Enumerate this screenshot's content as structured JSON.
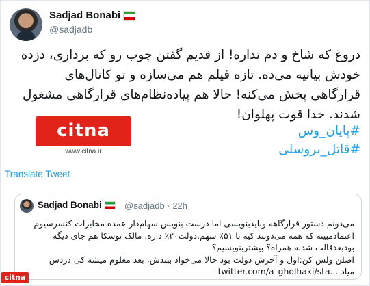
{
  "tweet": {
    "author_name": "Sadjad Bonabi",
    "author_handle": "@sadjadb",
    "text": "دروغ که شاخ و دم نداره! از قدیم گفتن چوب رو که برداری، دزده خودش بیانیه می‌ده. تازه فیلم هم می‌سازه و تو کانال‌های قرارگاهی پخش می‌کنه! حالا هم پیاده‌نظام‌های قرارگاهی مشغول شدند. خدا قوت پهلوان!",
    "hashtags": [
      "#پایان_وس",
      "#قاتل_بروسلی"
    ],
    "translate_label": "Translate Tweet"
  },
  "quoted_tweet": {
    "author_name": "Sadjad Bonabi",
    "author_handle": "@sadjadb",
    "time": "22h",
    "lines": [
      "می‌دونم دستور قرارگاهه وبایدبنویسی اما درست بنویس سهام‌دار عمده مخابرات کنسرسیوم",
      "اعتمادمبینه که همه می‌دونند کیه با ۵۱٪ سهم.دولت۲۰٪ داره. مالک توسکا هم جای دیگه",
      "بودبعدقالب شدبه همراه؟ بیشتربنویسیم؟",
      "اصلن ولش کن:اول و آخرش دولت بود حالا می‌خواد ببندش، بعد معلوم میشه کی دردش"
    ],
    "last_line_link": "twitter.com/a_gholhaki/sta...",
    "last_line_text": "میاد"
  },
  "logo": {
    "brand": "citna",
    "url": "www.citna.ir"
  },
  "watermark": "citna",
  "colors": {
    "accent": "#1da1f2",
    "brand_red": "#e2231a",
    "muted": "#657786",
    "border": "#ccd6dd"
  },
  "icons": {
    "flag": "iran-flag-icon"
  }
}
